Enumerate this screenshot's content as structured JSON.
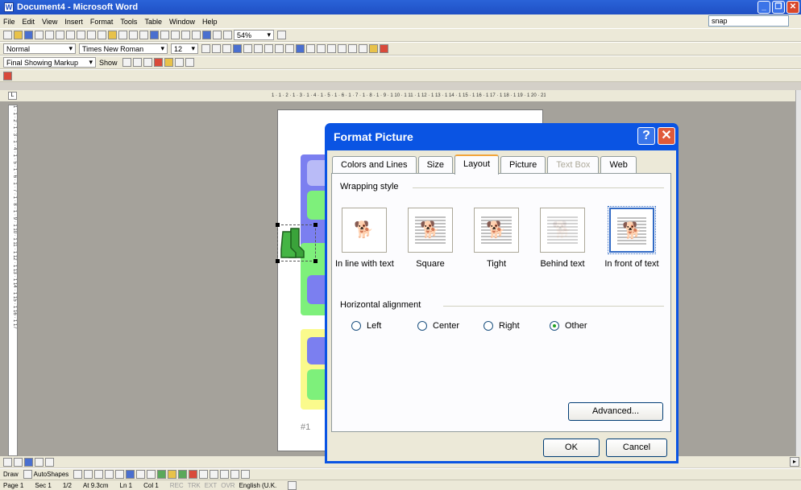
{
  "window": {
    "title": "Document4 - Microsoft Word",
    "ask_box": "snap"
  },
  "menu": [
    "File",
    "Edit",
    "View",
    "Insert",
    "Format",
    "Tools",
    "Table",
    "Window",
    "Help"
  ],
  "toolbar": {
    "zoom": "54%",
    "style": "Normal",
    "font": "Times New Roman",
    "font_size": "12",
    "markup": "Final Showing Markup",
    "show_label": "Show"
  },
  "ruler": {
    "horizontal": "1 · 1 · 2 · 1 · 3 · 1 · 4 · 1 · 5 · 1 · 6 · 1 · 7 · 1 · 8 · 1 · 9 · 1 10 · 1 11 · 1 12 · 1 13 · 1 14 · 1 15 · 1 16 · 1 17 · 1 18 · 1 19 · 1 20 · 21",
    "vertical": "1 · 1 · 2 · 1 · 3 · 1 · 4 · 1 · 5 · 1 · 6 · 1 · 7 · 1 · 8 · 1 · 9 · 1 10 · 1 11 · 1 12 · 1 13 · 1 14 · 1 15 · 1 16 · 1 17"
  },
  "document": {
    "page_number_label": "#1"
  },
  "draw_toolbar": {
    "draw": "Draw",
    "autoshapes": "AutoShapes"
  },
  "status": {
    "page": "Page 1",
    "section": "Sec 1",
    "pages": "1/2",
    "at": "At 9.3cm",
    "line": "Ln 1",
    "col": "Col 1",
    "rec": "REC",
    "trk": "TRK",
    "ext": "EXT",
    "ovr": "OVR",
    "language": "English (U.K."
  },
  "dialog": {
    "title": "Format Picture",
    "tabs": [
      "Colors and Lines",
      "Size",
      "Layout",
      "Picture",
      "Text Box",
      "Web"
    ],
    "active_tab": "Layout",
    "disabled_tab": "Text Box",
    "wrapping_group": "Wrapping style",
    "wrapping_options": [
      "In line with text",
      "Square",
      "Tight",
      "Behind text",
      "In front of text"
    ],
    "selected_wrapping": "In front of text",
    "alignment_group": "Horizontal alignment",
    "alignment_options": [
      "Left",
      "Center",
      "Right",
      "Other"
    ],
    "selected_alignment": "Other",
    "advanced_button": "Advanced...",
    "ok_button": "OK",
    "cancel_button": "Cancel"
  },
  "colors": {
    "title_blue": "#0a54e3",
    "card_blue": "#7b7ff0",
    "card_green": "#7ef07b",
    "card_yellow": "#fafa8c",
    "boot_green": "#3aa33a"
  }
}
